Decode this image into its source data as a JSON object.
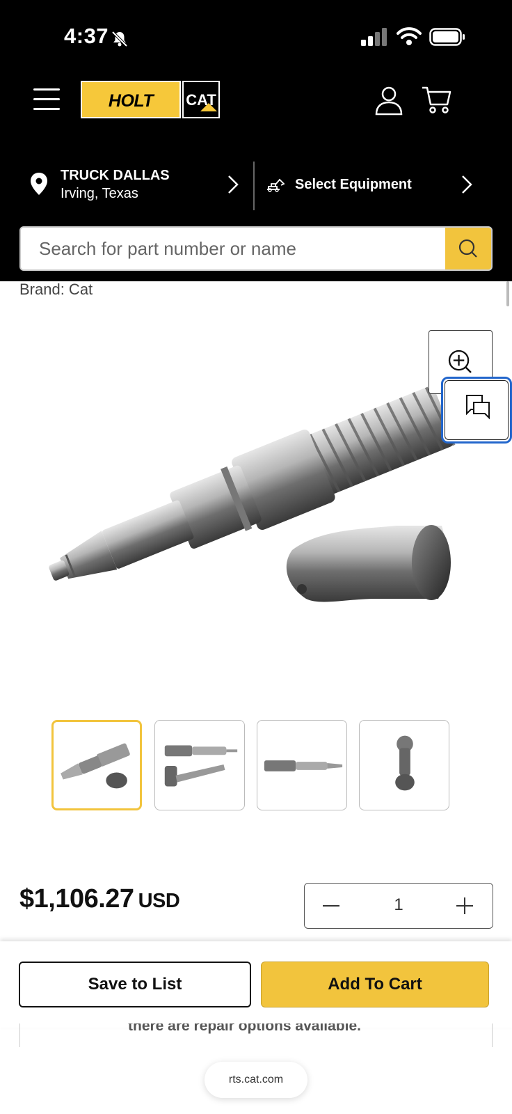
{
  "status_bar": {
    "time": "4:37"
  },
  "header": {
    "logo": {
      "holt": "HOLT",
      "cat": "CAT"
    },
    "location": {
      "name": "TRUCK DALLAS",
      "city": "Irving, Texas"
    },
    "equipment_label": "Select Equipment",
    "search": {
      "placeholder": "Search for part number or name",
      "value": ""
    }
  },
  "product": {
    "brand": "Brand: Cat",
    "price": "$1,106.27",
    "currency": "USD",
    "quantity": "1",
    "thumbnails": [
      "injector-angled",
      "injector-pair",
      "injector-side",
      "injector-end"
    ],
    "active_thumbnail": 0
  },
  "actions": {
    "save_label": "Save to List",
    "add_label": "Add To Cart"
  },
  "partial_text": "there are repair options available.",
  "browser": {
    "url": "rts.cat.com"
  },
  "colors": {
    "accent": "#f2c43d",
    "header_bg": "#000000",
    "focus": "#2266cc"
  }
}
